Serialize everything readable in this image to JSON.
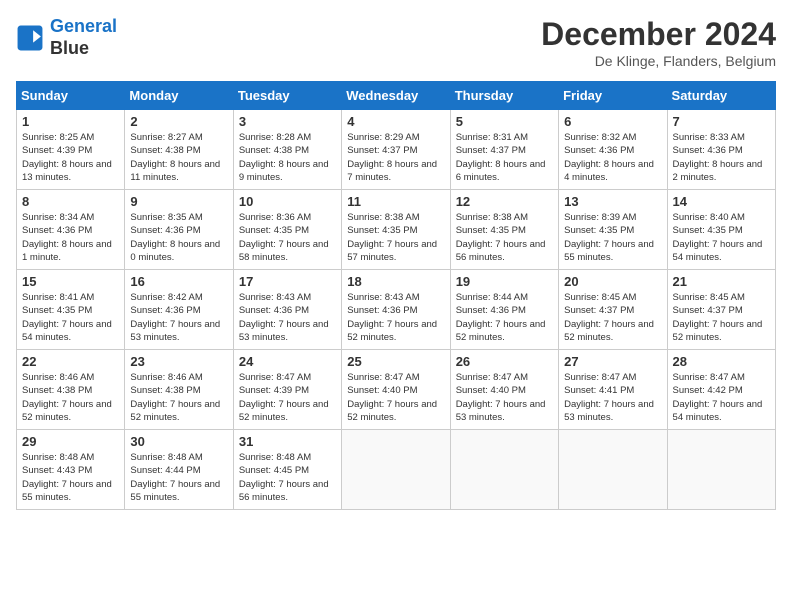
{
  "header": {
    "logo_line1": "General",
    "logo_line2": "Blue",
    "month": "December 2024",
    "location": "De Klinge, Flanders, Belgium"
  },
  "days_of_week": [
    "Sunday",
    "Monday",
    "Tuesday",
    "Wednesday",
    "Thursday",
    "Friday",
    "Saturday"
  ],
  "weeks": [
    [
      {
        "day": "1",
        "rise": "8:25 AM",
        "set": "4:39 PM",
        "daylight": "8 hours and 13 minutes."
      },
      {
        "day": "2",
        "rise": "8:27 AM",
        "set": "4:38 PM",
        "daylight": "8 hours and 11 minutes."
      },
      {
        "day": "3",
        "rise": "8:28 AM",
        "set": "4:38 PM",
        "daylight": "8 hours and 9 minutes."
      },
      {
        "day": "4",
        "rise": "8:29 AM",
        "set": "4:37 PM",
        "daylight": "8 hours and 7 minutes."
      },
      {
        "day": "5",
        "rise": "8:31 AM",
        "set": "4:37 PM",
        "daylight": "8 hours and 6 minutes."
      },
      {
        "day": "6",
        "rise": "8:32 AM",
        "set": "4:36 PM",
        "daylight": "8 hours and 4 minutes."
      },
      {
        "day": "7",
        "rise": "8:33 AM",
        "set": "4:36 PM",
        "daylight": "8 hours and 2 minutes."
      }
    ],
    [
      {
        "day": "8",
        "rise": "8:34 AM",
        "set": "4:36 PM",
        "daylight": "8 hours and 1 minute."
      },
      {
        "day": "9",
        "rise": "8:35 AM",
        "set": "4:36 PM",
        "daylight": "8 hours and 0 minutes."
      },
      {
        "day": "10",
        "rise": "8:36 AM",
        "set": "4:35 PM",
        "daylight": "7 hours and 58 minutes."
      },
      {
        "day": "11",
        "rise": "8:38 AM",
        "set": "4:35 PM",
        "daylight": "7 hours and 57 minutes."
      },
      {
        "day": "12",
        "rise": "8:38 AM",
        "set": "4:35 PM",
        "daylight": "7 hours and 56 minutes."
      },
      {
        "day": "13",
        "rise": "8:39 AM",
        "set": "4:35 PM",
        "daylight": "7 hours and 55 minutes."
      },
      {
        "day": "14",
        "rise": "8:40 AM",
        "set": "4:35 PM",
        "daylight": "7 hours and 54 minutes."
      }
    ],
    [
      {
        "day": "15",
        "rise": "8:41 AM",
        "set": "4:35 PM",
        "daylight": "7 hours and 54 minutes."
      },
      {
        "day": "16",
        "rise": "8:42 AM",
        "set": "4:36 PM",
        "daylight": "7 hours and 53 minutes."
      },
      {
        "day": "17",
        "rise": "8:43 AM",
        "set": "4:36 PM",
        "daylight": "7 hours and 53 minutes."
      },
      {
        "day": "18",
        "rise": "8:43 AM",
        "set": "4:36 PM",
        "daylight": "7 hours and 52 minutes."
      },
      {
        "day": "19",
        "rise": "8:44 AM",
        "set": "4:36 PM",
        "daylight": "7 hours and 52 minutes."
      },
      {
        "day": "20",
        "rise": "8:45 AM",
        "set": "4:37 PM",
        "daylight": "7 hours and 52 minutes."
      },
      {
        "day": "21",
        "rise": "8:45 AM",
        "set": "4:37 PM",
        "daylight": "7 hours and 52 minutes."
      }
    ],
    [
      {
        "day": "22",
        "rise": "8:46 AM",
        "set": "4:38 PM",
        "daylight": "7 hours and 52 minutes."
      },
      {
        "day": "23",
        "rise": "8:46 AM",
        "set": "4:38 PM",
        "daylight": "7 hours and 52 minutes."
      },
      {
        "day": "24",
        "rise": "8:47 AM",
        "set": "4:39 PM",
        "daylight": "7 hours and 52 minutes."
      },
      {
        "day": "25",
        "rise": "8:47 AM",
        "set": "4:40 PM",
        "daylight": "7 hours and 52 minutes."
      },
      {
        "day": "26",
        "rise": "8:47 AM",
        "set": "4:40 PM",
        "daylight": "7 hours and 53 minutes."
      },
      {
        "day": "27",
        "rise": "8:47 AM",
        "set": "4:41 PM",
        "daylight": "7 hours and 53 minutes."
      },
      {
        "day": "28",
        "rise": "8:47 AM",
        "set": "4:42 PM",
        "daylight": "7 hours and 54 minutes."
      }
    ],
    [
      {
        "day": "29",
        "rise": "8:48 AM",
        "set": "4:43 PM",
        "daylight": "7 hours and 55 minutes."
      },
      {
        "day": "30",
        "rise": "8:48 AM",
        "set": "4:44 PM",
        "daylight": "7 hours and 55 minutes."
      },
      {
        "day": "31",
        "rise": "8:48 AM",
        "set": "4:45 PM",
        "daylight": "7 hours and 56 minutes."
      },
      null,
      null,
      null,
      null
    ]
  ]
}
